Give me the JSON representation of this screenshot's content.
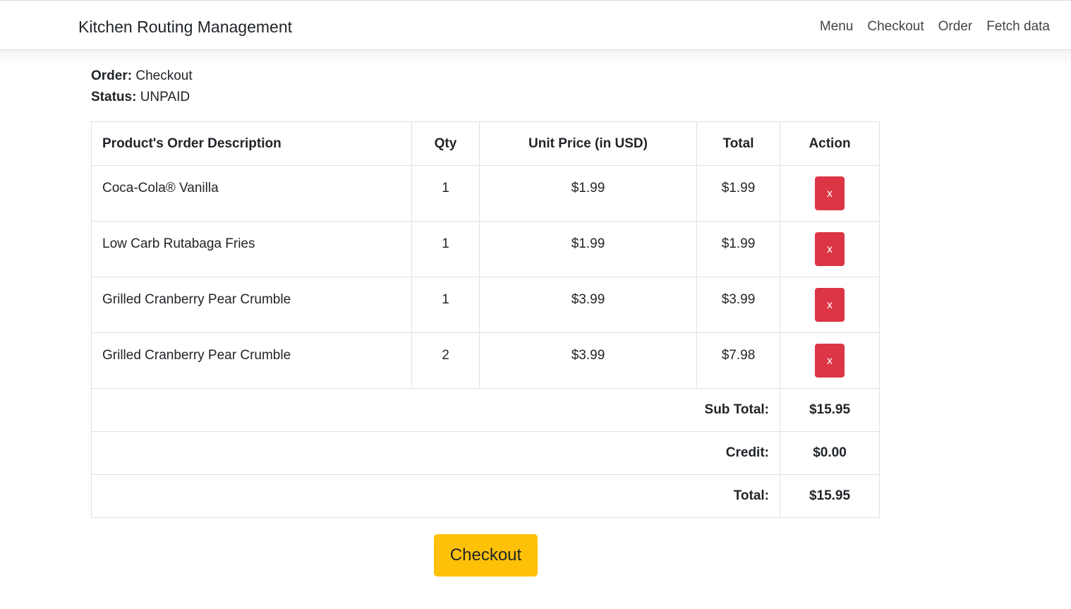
{
  "navbar": {
    "brand": "Kitchen Routing Management",
    "links": [
      "Menu",
      "Checkout",
      "Order",
      "Fetch data"
    ]
  },
  "order_info": {
    "order_label": "Order:",
    "order_value": "Checkout",
    "status_label": "Status:",
    "status_value": "UNPAID"
  },
  "table": {
    "headers": [
      "Product's Order Description",
      "Qty",
      "Unit Price (in USD)",
      "Total",
      "Action"
    ],
    "rows": [
      {
        "description": "Coca-Cola® Vanilla",
        "qty": "1",
        "unit_price": "$1.99",
        "total": "$1.99",
        "action": "x"
      },
      {
        "description": "Low Carb Rutabaga Fries",
        "qty": "1",
        "unit_price": "$1.99",
        "total": "$1.99",
        "action": "x"
      },
      {
        "description": "Grilled Cranberry Pear Crumble",
        "qty": "1",
        "unit_price": "$3.99",
        "total": "$3.99",
        "action": "x"
      },
      {
        "description": "Grilled Cranberry Pear Crumble",
        "qty": "2",
        "unit_price": "$3.99",
        "total": "$7.98",
        "action": "x"
      }
    ],
    "summary": [
      {
        "label": "Sub Total:",
        "value": "$15.95"
      },
      {
        "label": "Credit:",
        "value": "$0.00"
      },
      {
        "label": "Total:",
        "value": "$15.95"
      }
    ]
  },
  "checkout_button": "Checkout",
  "colors": {
    "danger": "#dc3545",
    "warning": "#ffc107",
    "border": "#dee2e6"
  }
}
